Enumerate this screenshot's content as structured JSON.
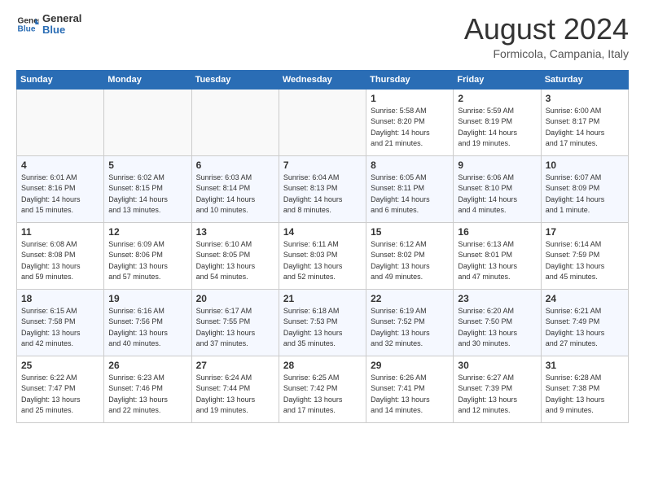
{
  "header": {
    "logo_general": "General",
    "logo_blue": "Blue",
    "month_year": "August 2024",
    "location": "Formicola, Campania, Italy"
  },
  "days_of_week": [
    "Sunday",
    "Monday",
    "Tuesday",
    "Wednesday",
    "Thursday",
    "Friday",
    "Saturday"
  ],
  "weeks": [
    [
      {
        "day": "",
        "info": ""
      },
      {
        "day": "",
        "info": ""
      },
      {
        "day": "",
        "info": ""
      },
      {
        "day": "",
        "info": ""
      },
      {
        "day": "1",
        "info": "Sunrise: 5:58 AM\nSunset: 8:20 PM\nDaylight: 14 hours\nand 21 minutes."
      },
      {
        "day": "2",
        "info": "Sunrise: 5:59 AM\nSunset: 8:19 PM\nDaylight: 14 hours\nand 19 minutes."
      },
      {
        "day": "3",
        "info": "Sunrise: 6:00 AM\nSunset: 8:17 PM\nDaylight: 14 hours\nand 17 minutes."
      }
    ],
    [
      {
        "day": "4",
        "info": "Sunrise: 6:01 AM\nSunset: 8:16 PM\nDaylight: 14 hours\nand 15 minutes."
      },
      {
        "day": "5",
        "info": "Sunrise: 6:02 AM\nSunset: 8:15 PM\nDaylight: 14 hours\nand 13 minutes."
      },
      {
        "day": "6",
        "info": "Sunrise: 6:03 AM\nSunset: 8:14 PM\nDaylight: 14 hours\nand 10 minutes."
      },
      {
        "day": "7",
        "info": "Sunrise: 6:04 AM\nSunset: 8:13 PM\nDaylight: 14 hours\nand 8 minutes."
      },
      {
        "day": "8",
        "info": "Sunrise: 6:05 AM\nSunset: 8:11 PM\nDaylight: 14 hours\nand 6 minutes."
      },
      {
        "day": "9",
        "info": "Sunrise: 6:06 AM\nSunset: 8:10 PM\nDaylight: 14 hours\nand 4 minutes."
      },
      {
        "day": "10",
        "info": "Sunrise: 6:07 AM\nSunset: 8:09 PM\nDaylight: 14 hours\nand 1 minute."
      }
    ],
    [
      {
        "day": "11",
        "info": "Sunrise: 6:08 AM\nSunset: 8:08 PM\nDaylight: 13 hours\nand 59 minutes."
      },
      {
        "day": "12",
        "info": "Sunrise: 6:09 AM\nSunset: 8:06 PM\nDaylight: 13 hours\nand 57 minutes."
      },
      {
        "day": "13",
        "info": "Sunrise: 6:10 AM\nSunset: 8:05 PM\nDaylight: 13 hours\nand 54 minutes."
      },
      {
        "day": "14",
        "info": "Sunrise: 6:11 AM\nSunset: 8:03 PM\nDaylight: 13 hours\nand 52 minutes."
      },
      {
        "day": "15",
        "info": "Sunrise: 6:12 AM\nSunset: 8:02 PM\nDaylight: 13 hours\nand 49 minutes."
      },
      {
        "day": "16",
        "info": "Sunrise: 6:13 AM\nSunset: 8:01 PM\nDaylight: 13 hours\nand 47 minutes."
      },
      {
        "day": "17",
        "info": "Sunrise: 6:14 AM\nSunset: 7:59 PM\nDaylight: 13 hours\nand 45 minutes."
      }
    ],
    [
      {
        "day": "18",
        "info": "Sunrise: 6:15 AM\nSunset: 7:58 PM\nDaylight: 13 hours\nand 42 minutes."
      },
      {
        "day": "19",
        "info": "Sunrise: 6:16 AM\nSunset: 7:56 PM\nDaylight: 13 hours\nand 40 minutes."
      },
      {
        "day": "20",
        "info": "Sunrise: 6:17 AM\nSunset: 7:55 PM\nDaylight: 13 hours\nand 37 minutes."
      },
      {
        "day": "21",
        "info": "Sunrise: 6:18 AM\nSunset: 7:53 PM\nDaylight: 13 hours\nand 35 minutes."
      },
      {
        "day": "22",
        "info": "Sunrise: 6:19 AM\nSunset: 7:52 PM\nDaylight: 13 hours\nand 32 minutes."
      },
      {
        "day": "23",
        "info": "Sunrise: 6:20 AM\nSunset: 7:50 PM\nDaylight: 13 hours\nand 30 minutes."
      },
      {
        "day": "24",
        "info": "Sunrise: 6:21 AM\nSunset: 7:49 PM\nDaylight: 13 hours\nand 27 minutes."
      }
    ],
    [
      {
        "day": "25",
        "info": "Sunrise: 6:22 AM\nSunset: 7:47 PM\nDaylight: 13 hours\nand 25 minutes."
      },
      {
        "day": "26",
        "info": "Sunrise: 6:23 AM\nSunset: 7:46 PM\nDaylight: 13 hours\nand 22 minutes."
      },
      {
        "day": "27",
        "info": "Sunrise: 6:24 AM\nSunset: 7:44 PM\nDaylight: 13 hours\nand 19 minutes."
      },
      {
        "day": "28",
        "info": "Sunrise: 6:25 AM\nSunset: 7:42 PM\nDaylight: 13 hours\nand 17 minutes."
      },
      {
        "day": "29",
        "info": "Sunrise: 6:26 AM\nSunset: 7:41 PM\nDaylight: 13 hours\nand 14 minutes."
      },
      {
        "day": "30",
        "info": "Sunrise: 6:27 AM\nSunset: 7:39 PM\nDaylight: 13 hours\nand 12 minutes."
      },
      {
        "day": "31",
        "info": "Sunrise: 6:28 AM\nSunset: 7:38 PM\nDaylight: 13 hours\nand 9 minutes."
      }
    ]
  ]
}
